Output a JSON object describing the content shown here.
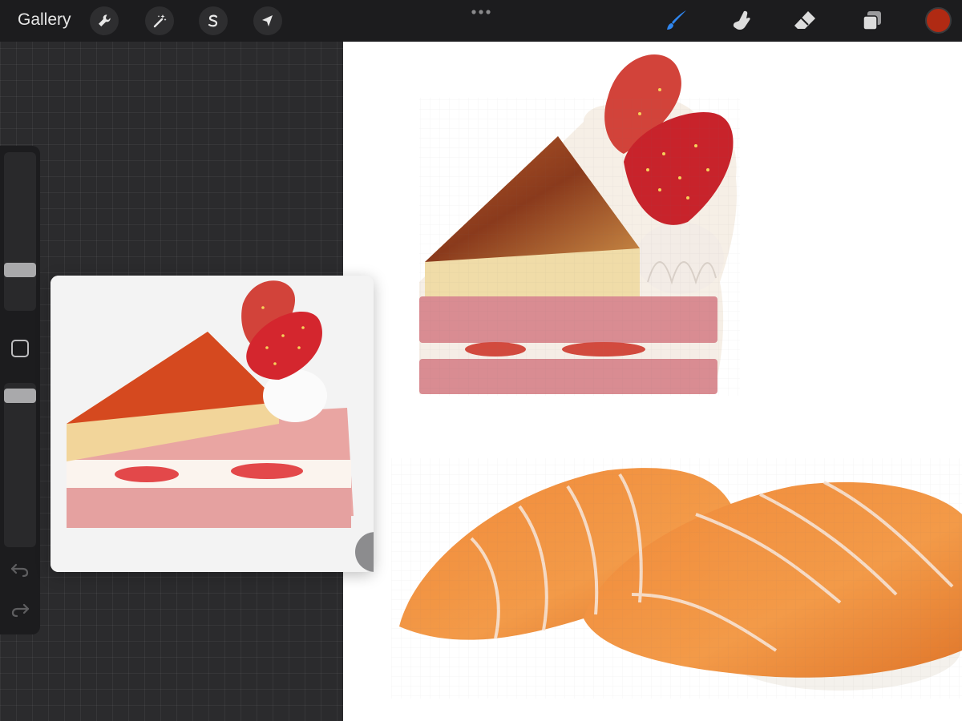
{
  "toolbar": {
    "gallery_label": "Gallery",
    "left_tools": [
      "wrench-icon",
      "magic-wand-icon",
      "selection-s-icon",
      "transform-arrow-icon"
    ],
    "right_tools": [
      "brush-icon",
      "smudge-icon",
      "eraser-icon",
      "layers-icon"
    ],
    "active_tool": "brush-icon",
    "current_color": "#b02a13",
    "accent_color": "#2f86ef"
  },
  "sidebar": {
    "brush_size": 0.4,
    "opacity": 0.9,
    "icons": [
      "modify-square-icon",
      "undo-icon",
      "redo-icon"
    ]
  },
  "reference": {
    "description_icon": "reference-image"
  }
}
